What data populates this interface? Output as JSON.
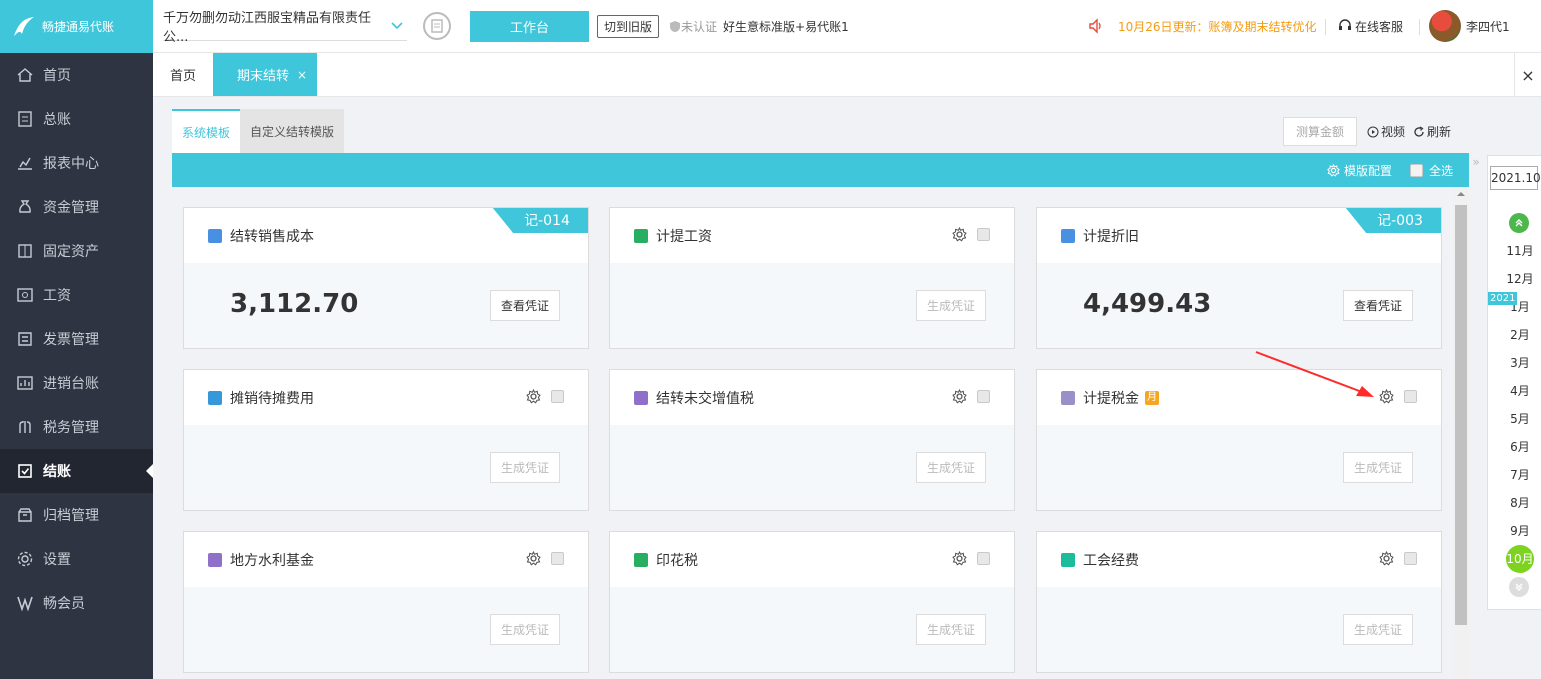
{
  "app": {
    "logo_text": "畅捷通易代账"
  },
  "header": {
    "company": "千万勿删勿动江西服宝精品有限责任公...",
    "workbench_label": "工作台",
    "old_version_label": "切到旧版",
    "auth_status": "未认证",
    "version": "好生意标准版+易代账1",
    "notice": "10月26日更新：账簿及期末结转优化",
    "service_label": "在线客服",
    "username": "李四代1"
  },
  "sidebar": {
    "items": [
      {
        "label": "首页",
        "icon": "home-icon"
      },
      {
        "label": "总账",
        "icon": "ledger-icon"
      },
      {
        "label": "报表中心",
        "icon": "report-icon"
      },
      {
        "label": "资金管理",
        "icon": "money-bag-icon"
      },
      {
        "label": "固定资产",
        "icon": "asset-icon"
      },
      {
        "label": "工资",
        "icon": "salary-icon"
      },
      {
        "label": "发票管理",
        "icon": "invoice-icon"
      },
      {
        "label": "进销台账",
        "icon": "inventory-icon"
      },
      {
        "label": "税务管理",
        "icon": "tax-icon"
      },
      {
        "label": "结账",
        "icon": "checkout-icon",
        "active": true
      },
      {
        "label": "归档管理",
        "icon": "archive-icon"
      },
      {
        "label": "设置",
        "icon": "settings-icon"
      },
      {
        "label": "畅会员",
        "icon": "vip-icon"
      }
    ]
  },
  "tabs": {
    "home": "首页",
    "current": "期末结转",
    "close": "×",
    "close_all": "×"
  },
  "subtabs": {
    "system": "系统模板",
    "custom": "自定义结转模版"
  },
  "toolbar": {
    "calc": "测算金额",
    "video": "视频",
    "refresh": "刷新",
    "template_config": "模版配置",
    "select_all": "全选"
  },
  "cards": [
    {
      "title": "结转销售成本",
      "amount": "3,112.70",
      "button": "查看凭证",
      "badge": "记-014",
      "icon_color": "#4a90e2"
    },
    {
      "title": "计提工资",
      "amount": "",
      "button": "生成凭证",
      "badge": "",
      "icon_color": "#27ae60"
    },
    {
      "title": "计提折旧",
      "amount": "4,499.43",
      "button": "查看凭证",
      "badge": "记-003",
      "icon_color": "#4a90e2"
    },
    {
      "title": "摊销待摊费用",
      "amount": "",
      "button": "生成凭证",
      "badge": "",
      "icon_color": "#3498db"
    },
    {
      "title": "结转未交增值税",
      "amount": "",
      "button": "生成凭证",
      "badge": "",
      "icon_color": "#8e6fc9"
    },
    {
      "title": "计提税金",
      "amount": "",
      "button": "生成凭证",
      "badge": "",
      "icon_color": "#9b8fc9",
      "tag": "月"
    },
    {
      "title": "地方水利基金",
      "amount": "",
      "button": "生成凭证",
      "badge": "",
      "icon_color": "#8e6fc9"
    },
    {
      "title": "印花税",
      "amount": "",
      "button": "生成凭证",
      "badge": "",
      "icon_color": "#27ae60"
    },
    {
      "title": "工会经费",
      "amount": "",
      "button": "生成凭证",
      "badge": "",
      "icon_color": "#1abc9c"
    }
  ],
  "months": {
    "current": "2021.10",
    "year_tag": "2021",
    "list": [
      "11月",
      "12月",
      "1月",
      "2月",
      "3月",
      "4月",
      "5月",
      "6月",
      "7月",
      "8月",
      "9月",
      "10月"
    ],
    "active": "10月"
  },
  "colors": {
    "accent": "#3fc6da",
    "sidebar": "#2f3442",
    "notice": "#f39c12"
  }
}
